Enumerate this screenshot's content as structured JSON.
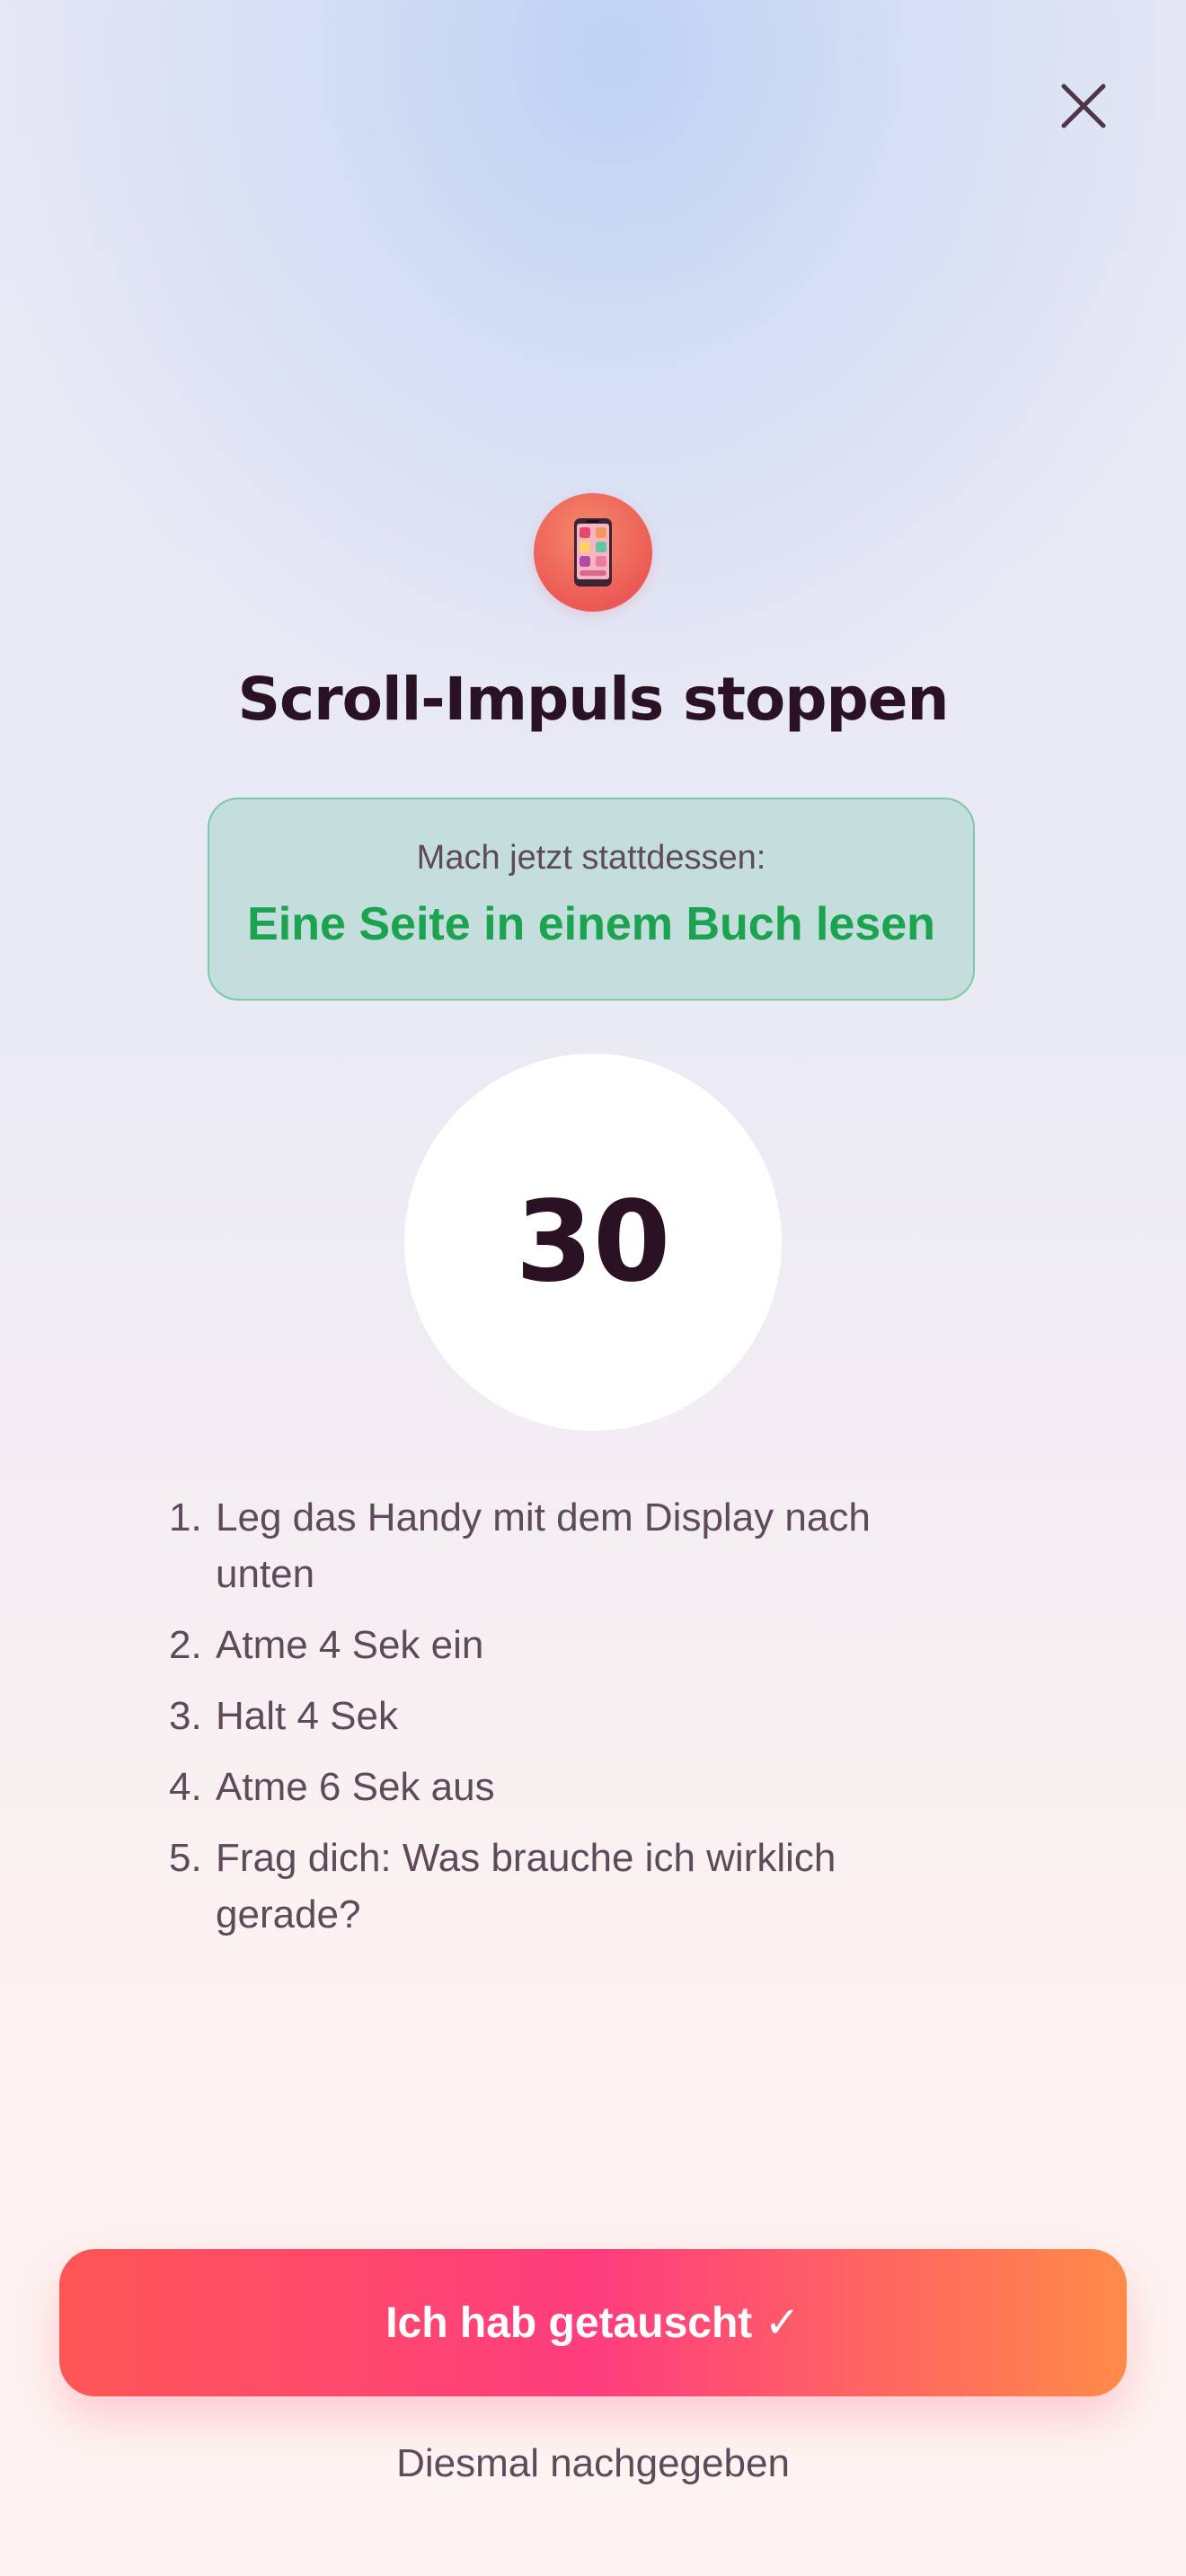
{
  "header": {
    "close_icon": "close-icon"
  },
  "hero": {
    "icon": "smartphone-icon",
    "title": "Scroll-Impuls stoppen"
  },
  "suggestion": {
    "caption": "Mach jetzt stattdessen:",
    "text": "Eine Seite in einem Buch lesen"
  },
  "timer": {
    "value": "30"
  },
  "steps": [
    {
      "number": "1.",
      "text": "Leg das Handy mit dem Display nach unten"
    },
    {
      "number": "2.",
      "text": "Atme 4 Sek ein"
    },
    {
      "number": "3.",
      "text": "Halt 4 Sek"
    },
    {
      "number": "4.",
      "text": "Atme 6 Sek aus"
    },
    {
      "number": "5.",
      "text": "Frag dich: Was brauche ich wirklich gerade?"
    }
  ],
  "actions": {
    "primary_label": "Ich hab getauscht ✓",
    "secondary_label": "Diesmal nachgegeben"
  },
  "colors": {
    "accent_green": "#1ca34f",
    "button_gradient_start": "#fd5656",
    "button_gradient_mid": "#fe3d7e",
    "button_gradient_end": "#ff8a48",
    "text_dark": "#2a1224",
    "text_muted": "#5e4a5a"
  }
}
